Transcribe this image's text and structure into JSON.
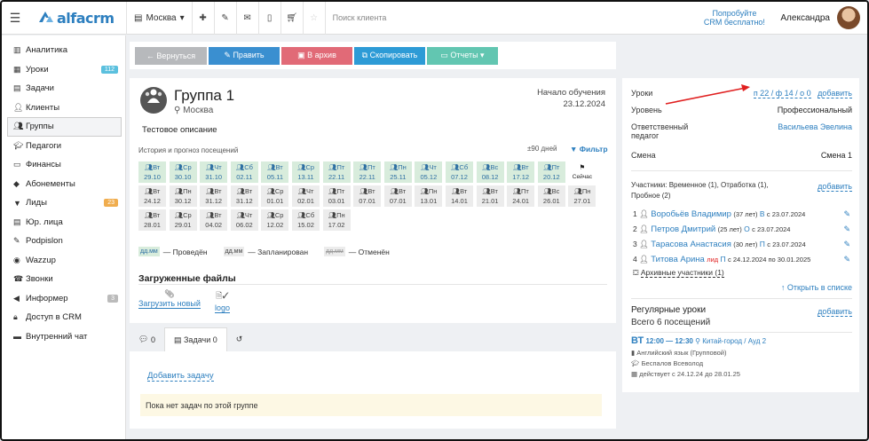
{
  "topbar": {
    "logo": "alfacrm",
    "city": "Москва",
    "search_placeholder": "Поиск клиента",
    "promo_line1": "Попробуйте",
    "promo_line2": "CRM бесплатно!",
    "user_name": "Александра"
  },
  "sidebar": [
    {
      "label": "Аналитика",
      "icon": "chart-icon"
    },
    {
      "label": "Уроки",
      "icon": "calendar-icon",
      "badge": "112",
      "badge_color": "#5bc0de"
    },
    {
      "label": "Задачи",
      "icon": "tasks-icon"
    },
    {
      "label": "Клиенты",
      "icon": "user-icon"
    },
    {
      "label": "Группы",
      "icon": "users-icon",
      "active": true
    },
    {
      "label": "Педагоги",
      "icon": "graduation-cap-icon"
    },
    {
      "label": "Финансы",
      "icon": "money-icon"
    },
    {
      "label": "Абонементы",
      "icon": "tag-icon"
    },
    {
      "label": "Лиды",
      "icon": "funnel-icon",
      "badge": "23",
      "badge_color": "#f0ad4e"
    },
    {
      "label": "Юр. лица",
      "icon": "building-icon"
    },
    {
      "label": "Podpislon",
      "icon": "pen-icon"
    },
    {
      "label": "Wazzup",
      "icon": "whatsapp-icon"
    },
    {
      "label": "Звонки",
      "icon": "phone-icon"
    },
    {
      "label": "Информер",
      "icon": "megaphone-icon",
      "badge": "3",
      "badge_color": "#bbb"
    },
    {
      "label": "Доступ в CRM",
      "icon": "lock-icon"
    },
    {
      "label": "Внутренний чат",
      "icon": "chat-icon"
    }
  ],
  "actions": [
    {
      "label": "← Вернуться",
      "color": "#b7b9bc"
    },
    {
      "label": "✎ Править",
      "color": "#3a8fd0"
    },
    {
      "label": "▣ В архив",
      "color": "#e16a77"
    },
    {
      "label": "⧉ Скопировать",
      "color": "#2d9bd6"
    },
    {
      "label": "▭ Отчеты ▾",
      "color": "#62c6b1"
    }
  ],
  "group": {
    "title": "Группа 1",
    "city": "Москва",
    "start_label": "Начало обучения",
    "start_date": "23.12.2024",
    "description": "Тестовое описание",
    "history_label": "История и прогноз посещений",
    "days_label": "±90 дней",
    "filter_label": "Фильтр"
  },
  "attendance": [
    {
      "day": "Вт",
      "date": "29.10",
      "s": "done"
    },
    {
      "day": "Ср",
      "date": "30.10",
      "s": "done"
    },
    {
      "day": "Чт",
      "date": "31.10",
      "s": "done"
    },
    {
      "day": "Сб",
      "date": "02.11",
      "s": "done"
    },
    {
      "day": "Вт",
      "date": "05.11",
      "s": "done"
    },
    {
      "day": "Ср",
      "date": "13.11",
      "s": "done"
    },
    {
      "day": "Пт",
      "date": "22.11",
      "s": "done"
    },
    {
      "day": "Пт",
      "date": "22.11",
      "s": "done"
    },
    {
      "day": "Пн",
      "date": "25.11",
      "s": "done"
    },
    {
      "day": "Чт",
      "date": "05.12",
      "s": "done"
    },
    {
      "day": "Сб",
      "date": "07.12",
      "s": "done"
    },
    {
      "day": "Вс",
      "date": "08.12",
      "s": "done"
    },
    {
      "day": "Вт",
      "date": "17.12",
      "s": "done"
    },
    {
      "day": "Пт",
      "date": "20.12",
      "s": "done"
    },
    {
      "day": "",
      "date": "Сейчас",
      "s": "now"
    },
    {
      "day": "Вт",
      "date": "24.12",
      "s": "plan"
    },
    {
      "day": "Пн",
      "date": "30.12",
      "s": "plan"
    },
    {
      "day": "Вт",
      "date": "31.12",
      "s": "plan"
    },
    {
      "day": "Вт",
      "date": "31.12",
      "s": "plan"
    },
    {
      "day": "Ср",
      "date": "01.01",
      "s": "plan"
    },
    {
      "day": "Чт",
      "date": "02.01",
      "s": "plan"
    },
    {
      "day": "Пт",
      "date": "03.01",
      "s": "plan"
    },
    {
      "day": "Вт",
      "date": "07.01",
      "s": "plan"
    },
    {
      "day": "Вт",
      "date": "07.01",
      "s": "plan"
    },
    {
      "day": "Пн",
      "date": "13.01",
      "s": "plan"
    },
    {
      "day": "Вт",
      "date": "14.01",
      "s": "plan"
    },
    {
      "day": "Вт",
      "date": "21.01",
      "s": "plan"
    },
    {
      "day": "Пт",
      "date": "24.01",
      "s": "plan"
    },
    {
      "day": "Вс",
      "date": "26.01",
      "s": "plan"
    },
    {
      "day": "Пн",
      "date": "27.01",
      "s": "plan"
    },
    {
      "day": "Вт",
      "date": "28.01",
      "s": "plan"
    },
    {
      "day": "Ср",
      "date": "29.01",
      "s": "plan"
    },
    {
      "day": "Вт",
      "date": "04.02",
      "s": "plan"
    },
    {
      "day": "Чт",
      "date": "06.02",
      "s": "plan"
    },
    {
      "day": "Ср",
      "date": "12.02",
      "s": "plan"
    },
    {
      "day": "Сб",
      "date": "15.02",
      "s": "plan"
    },
    {
      "day": "Пн",
      "date": "17.02",
      "s": "plan"
    }
  ],
  "legend": [
    {
      "box": "дд.мм",
      "label": "— Проведён",
      "color": "#d8ecdc",
      "text_color": "#2d6fa3"
    },
    {
      "box": "дд.мм",
      "label": "— Запланирован",
      "color": "#ececec",
      "text_color": "#444"
    },
    {
      "box": "дд.мм",
      "label": "— Отменён",
      "color": "#ececec",
      "text_color": "#999"
    }
  ],
  "files": {
    "title": "Загруженные файлы",
    "upload_label": "Загрузить новый",
    "file_name": "logo"
  },
  "tasks": {
    "tab_comments": "0",
    "tab_tasks": "Задачи 0",
    "add_label": "Добавить задачу",
    "empty_label": "Пока нет задач по этой группе"
  },
  "details": {
    "lessons_label": "Уроки",
    "lessons_value": "п 22 / ф 14 / о 0",
    "add_label": "добавить",
    "level_label": "Уровень",
    "level_value": "Профессиональный",
    "teacher_label_1": "Ответственный",
    "teacher_label_2": "педагог",
    "teacher_value": "Васильева Эвелина",
    "shift_label": "Смена",
    "shift_value": "Смена 1",
    "members_label": "Участники:",
    "members_sub_1": "Временное (1), Отработка (1),",
    "members_sub_2": "Пробное (2)",
    "members_add": "добавить",
    "members": [
      {
        "n": "1",
        "name": "Воробьёв Владимир",
        "age": "(37 лет)",
        "tag": "В",
        "since": "с 23.07.2024"
      },
      {
        "n": "2",
        "name": "Петров Дмитрий",
        "age": "(25 лет)",
        "tag": "О",
        "since": "с 23.07.2024"
      },
      {
        "n": "3",
        "name": "Тарасова Анастасия",
        "age": "(30 лет)",
        "tag": "П",
        "since": "с 23.07.2024"
      },
      {
        "n": "4",
        "name": "Титова Арина",
        "age": "лид",
        "tag": "П",
        "since": "с 24.12.2024 по 30.01.2025"
      }
    ],
    "archive_label": "Архивные участники (1)",
    "open_list": "Открыть в списке",
    "regular_title": "Регулярные уроки",
    "regular_add": "добавить",
    "regular_total": "Всего 6 посещений",
    "reg_day": "ВТ",
    "reg_time": "12:00 — 12:30",
    "reg_place": "Китай-город / Ауд 2",
    "reg_subject": "Английский язык (Групповой)",
    "reg_teacher": "Беспалов Всеволод",
    "reg_period": "действует с 24.12.24 до 28.01.25"
  }
}
